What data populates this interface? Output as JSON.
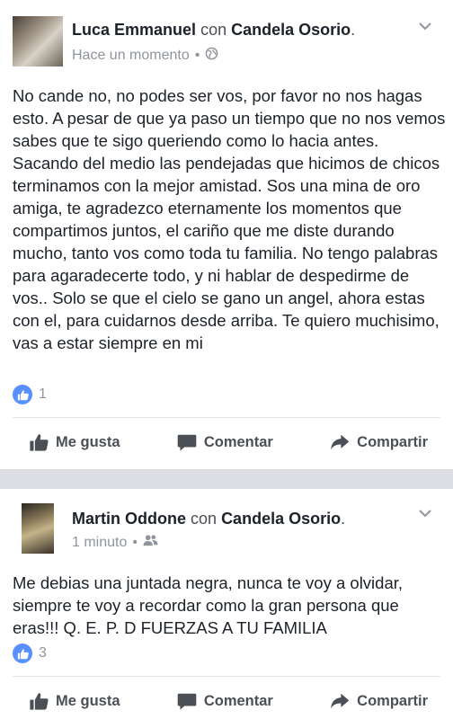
{
  "posts": [
    {
      "author": "Luca Emmanuel",
      "connector": "con",
      "tagged": "Candela Osorio",
      "time": "Hace un momento",
      "privacy_icon": "globe-icon",
      "text": "No cande no, no podes ser vos, por favor no nos hagas esto. A pesar de que ya paso un tiempo que no nos vemos sabes que te sigo queriendo como lo hacia antes. Sacando del medio las pendejadas que hicimos de chicos terminamos con la mejor amistad. Sos una mina de oro amiga, te agradezco eternamente los momentos que compartimos juntos, el cariño que me diste durando mucho, tanto vos como toda tu familia. No tengo palabras para agaradecerte todo, y ni hablar de despedirme de vos.. Solo se que el cielo se gano un angel, ahora estas con el, para cuidarnos desde arriba. Te quiero muchisimo, vas a estar siempre en mi",
      "like_count": "1"
    },
    {
      "author": "Martin Oddone",
      "connector": "con",
      "tagged": "Candela Osorio",
      "time": "1 minuto",
      "privacy_icon": "friends-icon",
      "text": "Me debias una juntada negra, nunca te voy a olvidar, siempre te voy a recordar como la gran persona que eras!!!  Q. E. P. D FUERZAS A TU FAMILIA",
      "like_count": "3"
    }
  ],
  "actions": {
    "like": "Me gusta",
    "comment": "Comentar",
    "share": "Compartir"
  },
  "colors": {
    "accent": "#5890ff",
    "text": "#1d2129",
    "meta": "#90949c",
    "action": "#4b4f56",
    "separator": "#dcdee3"
  }
}
